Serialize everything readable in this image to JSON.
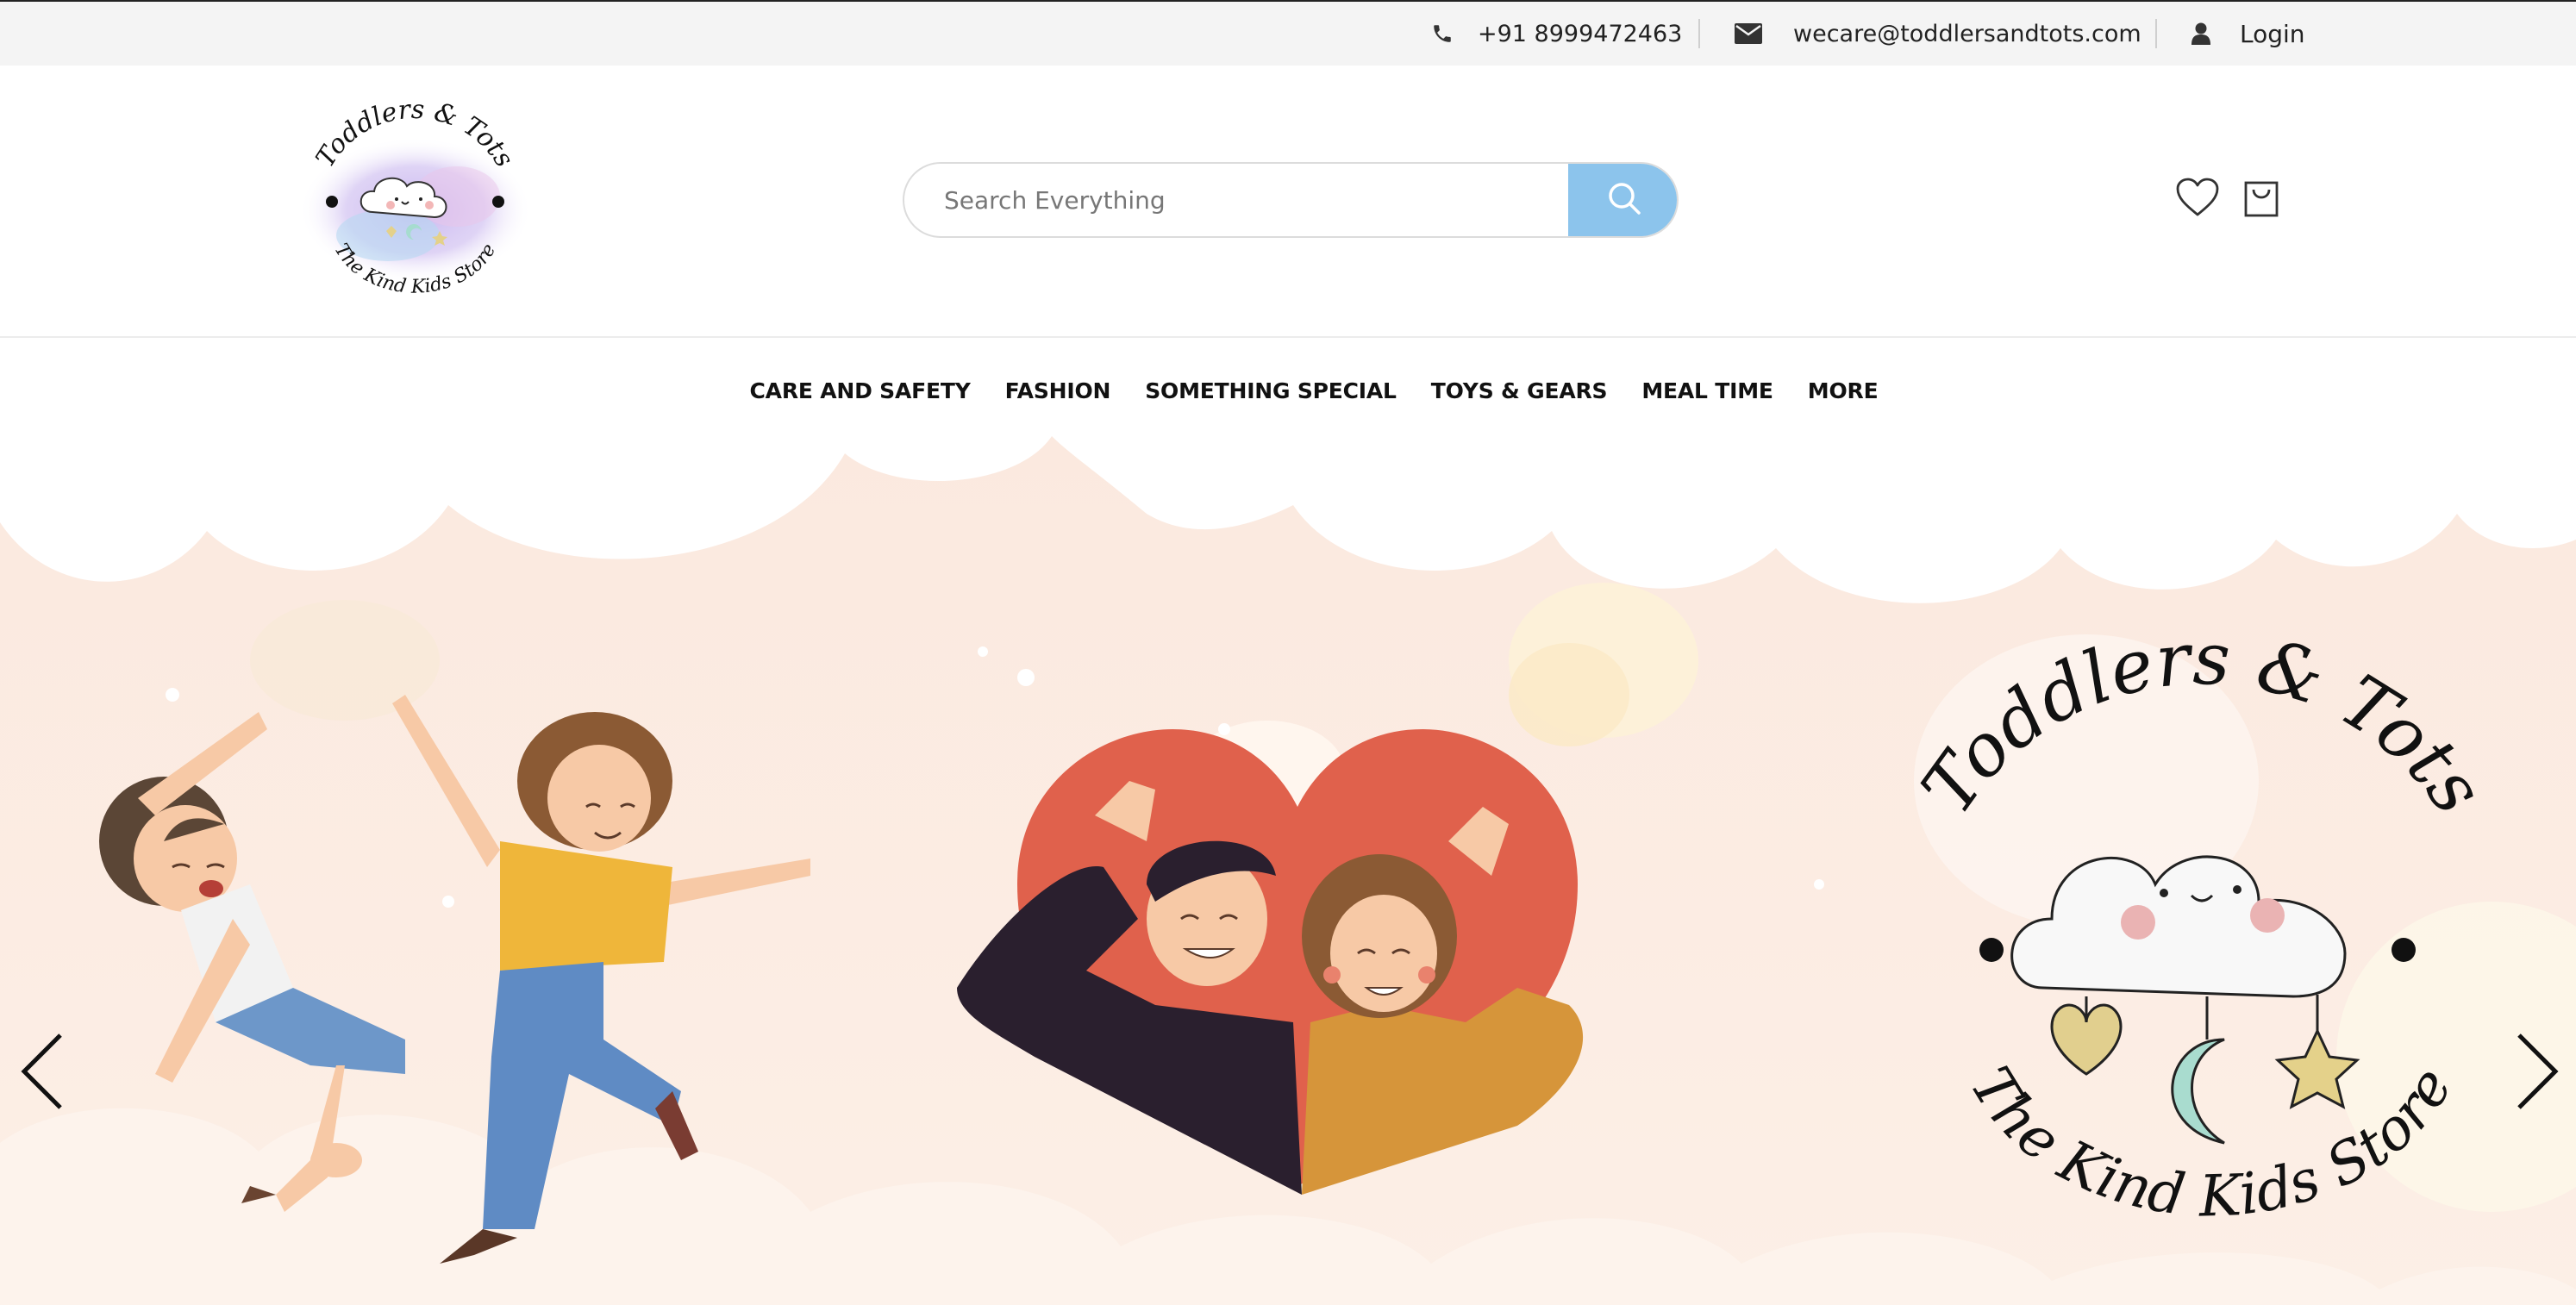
{
  "topbar": {
    "phone": "+91 8999472463",
    "email": "wecare@toddlersandtots.com",
    "login": "Login",
    "icons": [
      "phone-icon",
      "envelope-icon",
      "user-icon"
    ]
  },
  "logo": {
    "top_text": "Toddlers & Tots",
    "bottom_text": "The Kind Kids Store"
  },
  "search": {
    "placeholder": "Search Everything",
    "button_icon": "search-icon"
  },
  "header_icons": [
    "heart-icon",
    "shopping-bag-icon"
  ],
  "nav": {
    "items": [
      "CARE AND SAFETY",
      "FASHION",
      "SOMETHING SPECIAL",
      "TOYS & GEARS",
      "MEAL TIME",
      "MORE"
    ]
  },
  "hero": {
    "logo_top_text": "Toddlers & Tots",
    "logo_bottom_text": "The Kind Kids Store",
    "prev_icon": "chevron-left-icon",
    "next_icon": "chevron-right-icon"
  },
  "colors": {
    "accent": "#8cc4ec",
    "topbar_bg": "#f4f4f4",
    "hero_bg": "#fbe5d6",
    "heart": "#e0614c"
  }
}
